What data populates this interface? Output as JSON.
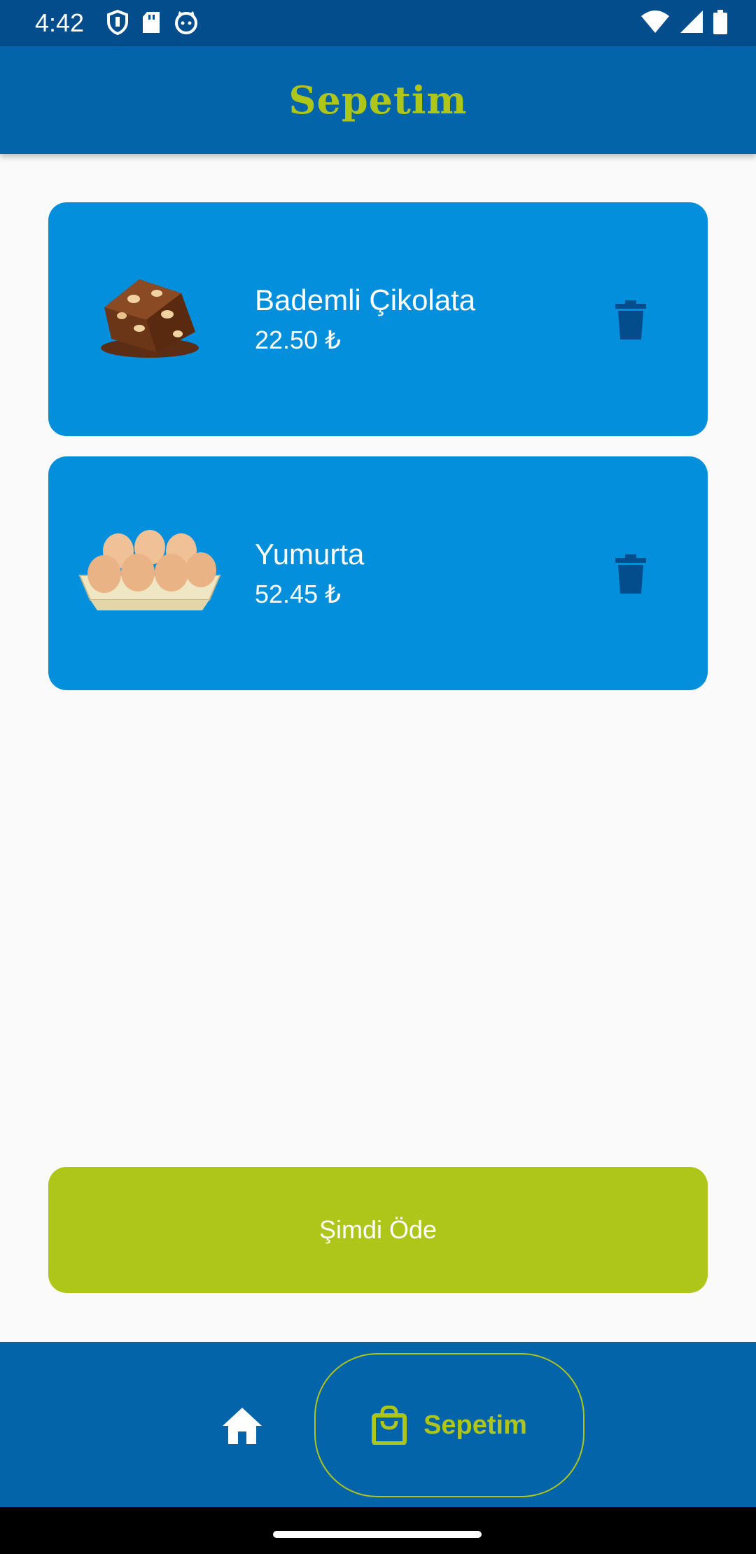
{
  "status_bar": {
    "time": "4:42",
    "left_icons": [
      "shield-icon",
      "sd-card-icon",
      "cat-face-icon"
    ],
    "right_icons": [
      "wifi-icon",
      "signal-icon",
      "battery-icon"
    ]
  },
  "app_bar": {
    "title": "Sepetim"
  },
  "cart_items": [
    {
      "name": "Bademli Çikolata",
      "price": "22.50 ₺",
      "image_icon": "almond-chocolate-image",
      "delete_icon": "trash-icon"
    },
    {
      "name": "Yumurta",
      "price": "52.45 ₺",
      "image_icon": "egg-carton-image",
      "delete_icon": "trash-icon"
    }
  ],
  "pay_button": {
    "label": "Şimdi Öde"
  },
  "bottom_nav": {
    "items": [
      {
        "icon": "home-icon",
        "label": "",
        "selected": false
      },
      {
        "icon": "shopping-bag-icon",
        "label": "Sepetim",
        "selected": true
      }
    ]
  },
  "colors": {
    "status_bar": "#034d8c",
    "app_bar": "#0464aa",
    "card": "#048fdd",
    "accent": "#aec61a",
    "trash": "#034d8c",
    "background": "#fafafa"
  }
}
